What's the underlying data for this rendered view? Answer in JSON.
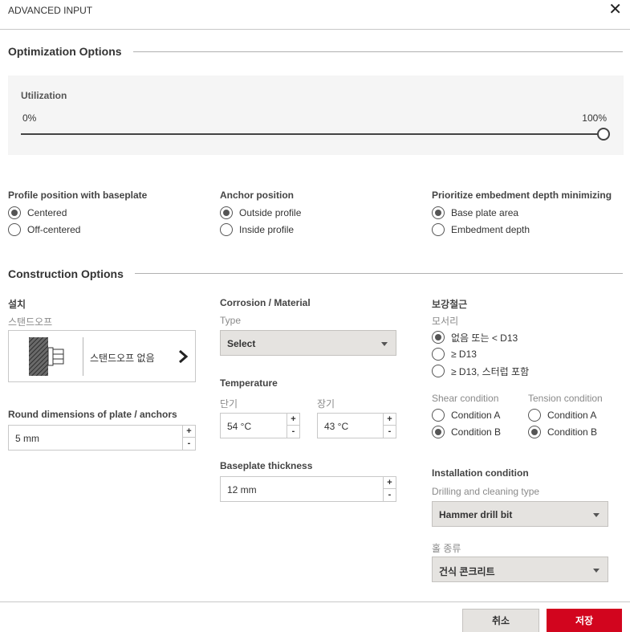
{
  "dialog": {
    "title": "ADVANCED INPUT",
    "close_icon": "close-icon"
  },
  "optimization": {
    "title": "Optimization Options",
    "utilization": {
      "label": "Utilization",
      "min_label": "0%",
      "max_label": "100%",
      "value": 100
    },
    "profile_position": {
      "title": "Profile position with baseplate",
      "options": [
        {
          "label": "Centered",
          "selected": true
        },
        {
          "label": "Off-centered",
          "selected": false
        }
      ]
    },
    "anchor_position": {
      "title": "Anchor position",
      "options": [
        {
          "label": "Outside profile",
          "selected": true
        },
        {
          "label": "Inside profile",
          "selected": false
        }
      ]
    },
    "prioritize": {
      "title": "Prioritize embedment depth minimizing",
      "options": [
        {
          "label": "Base plate area",
          "selected": true
        },
        {
          "label": "Embedment depth",
          "selected": false
        }
      ]
    }
  },
  "construction": {
    "title": "Construction Options",
    "installation": {
      "title": "설치",
      "standoff_label": "스탠드오프",
      "standoff_value": "스탠드오프 없음"
    },
    "round_dimensions": {
      "label": "Round dimensions of plate / anchors",
      "value": "5 mm",
      "plus": "+",
      "minus": "-"
    },
    "corrosion": {
      "title": "Corrosion / Material",
      "type_label": "Type",
      "type_value": "Select"
    },
    "temperature": {
      "title": "Temperature",
      "short_label": "단기",
      "short_value": "54 °C",
      "long_label": "장기",
      "long_value": "43 °C",
      "plus": "+",
      "minus": "-"
    },
    "baseplate_thickness": {
      "label": "Baseplate thickness",
      "value": "12 mm",
      "plus": "+",
      "minus": "-"
    },
    "reinforcement": {
      "title": "보강철근",
      "edge_label": "모서리",
      "edge_options": [
        {
          "label": "없음 또는 < D13",
          "selected": true
        },
        {
          "label": "≥ D13",
          "selected": false
        },
        {
          "label": "≥ D13, 스터럽 포함",
          "selected": false
        }
      ],
      "shear_label": "Shear condition",
      "shear_options": [
        {
          "label": "Condition A",
          "selected": false
        },
        {
          "label": "Condition B",
          "selected": true
        }
      ],
      "tension_label": "Tension condition",
      "tension_options": [
        {
          "label": "Condition A",
          "selected": false
        },
        {
          "label": "Condition B",
          "selected": true
        }
      ]
    },
    "installation_condition": {
      "title": "Installation condition",
      "drilling_label": "Drilling and cleaning type",
      "drilling_value": "Hammer drill bit",
      "hole_label": "홀 종류",
      "hole_value": "건식 콘크리트"
    }
  },
  "footer": {
    "cancel_label": "취소",
    "save_label": "저장"
  },
  "colors": {
    "accent": "#d2051e",
    "select_bg": "#e5e3e0",
    "panel_bg": "#f5f5f5"
  }
}
